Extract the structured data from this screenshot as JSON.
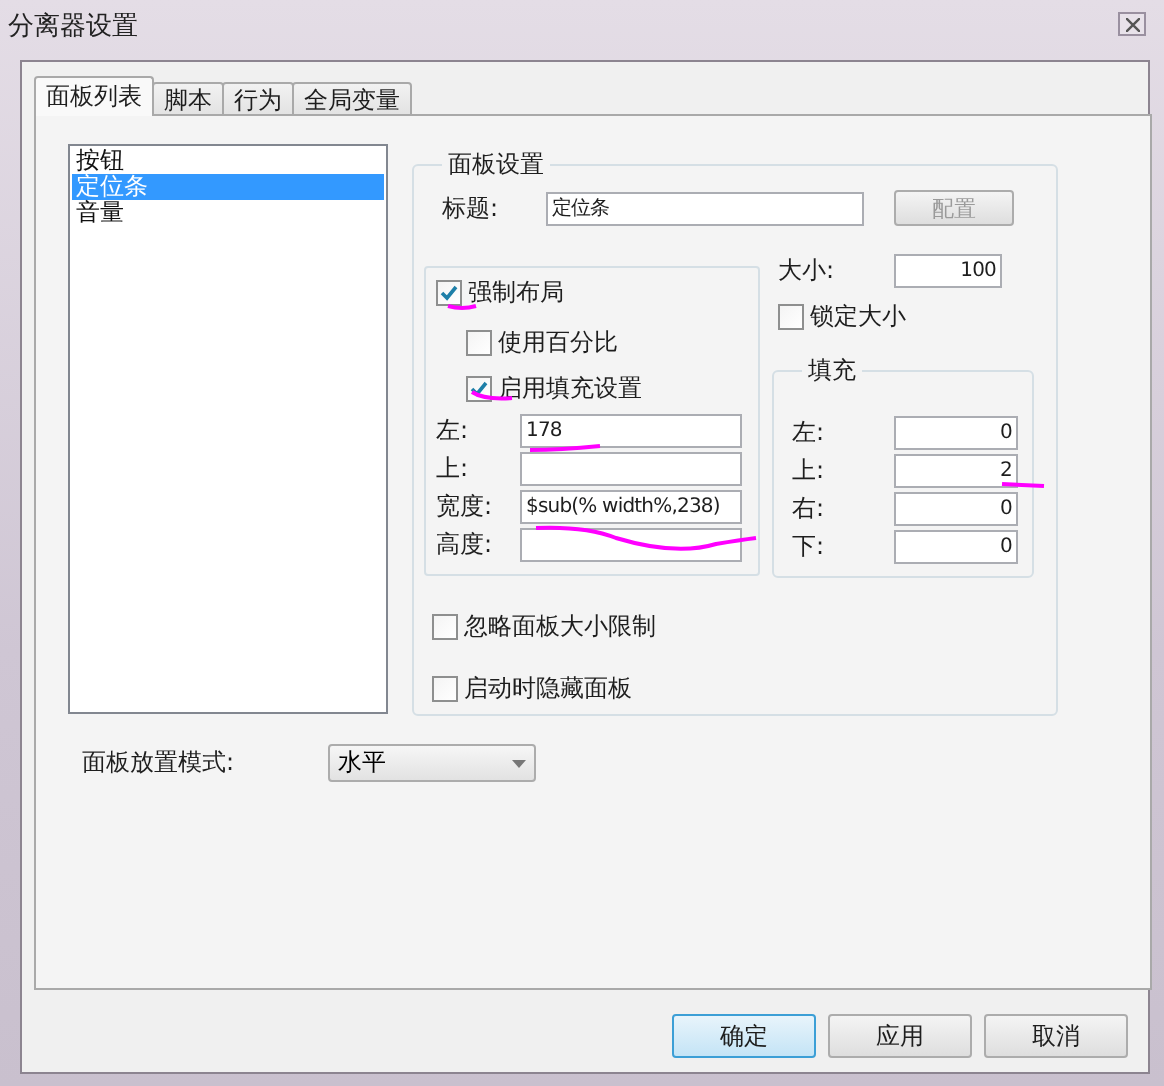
{
  "window": {
    "title": "分离器设置"
  },
  "tabs": [
    {
      "label": "面板列表",
      "selected": true
    },
    {
      "label": "脚本",
      "selected": false
    },
    {
      "label": "行为",
      "selected": false
    },
    {
      "label": "全局变量",
      "selected": false
    }
  ],
  "panel_list": {
    "items": [
      {
        "label": "按钮",
        "selected": false
      },
      {
        "label": "定位条",
        "selected": true
      },
      {
        "label": "音量",
        "selected": false
      }
    ]
  },
  "panel_settings": {
    "legend": "面板设置",
    "title_label": "标题:",
    "title_value": "定位条",
    "config_button": "配置"
  },
  "force_layout": {
    "label": "强制布局",
    "checked": true,
    "use_percent": {
      "label": "使用百分比",
      "checked": false
    },
    "enable_fill": {
      "label": "启用填充设置",
      "checked": true
    },
    "fields": [
      {
        "label": "左:",
        "value": "178"
      },
      {
        "label": "上:"
      },
      {
        "label": "宽度:",
        "value": "$sub(% width%,238)"
      },
      {
        "label": "高度:"
      }
    ]
  },
  "size": {
    "label": "大小:",
    "value": "100"
  },
  "lock_size": {
    "label": "锁定大小",
    "checked": false
  },
  "fill": {
    "legend": "填充",
    "fields": [
      {
        "label": "左:",
        "value": "0"
      },
      {
        "label": "上:",
        "value": "2"
      },
      {
        "label": "右:",
        "value": "0"
      },
      {
        "label": "下:",
        "value": "0"
      }
    ]
  },
  "options": [
    {
      "label": "忽略面板大小限制",
      "checked": false
    },
    {
      "label": "启动时隐藏面板",
      "checked": false
    }
  ],
  "placement": {
    "label": "面板放置模式:",
    "value": "水平"
  },
  "buttons": [
    {
      "label": "确定",
      "default": true
    },
    {
      "label": "应用",
      "default": false
    },
    {
      "label": "取消",
      "default": false
    }
  ]
}
